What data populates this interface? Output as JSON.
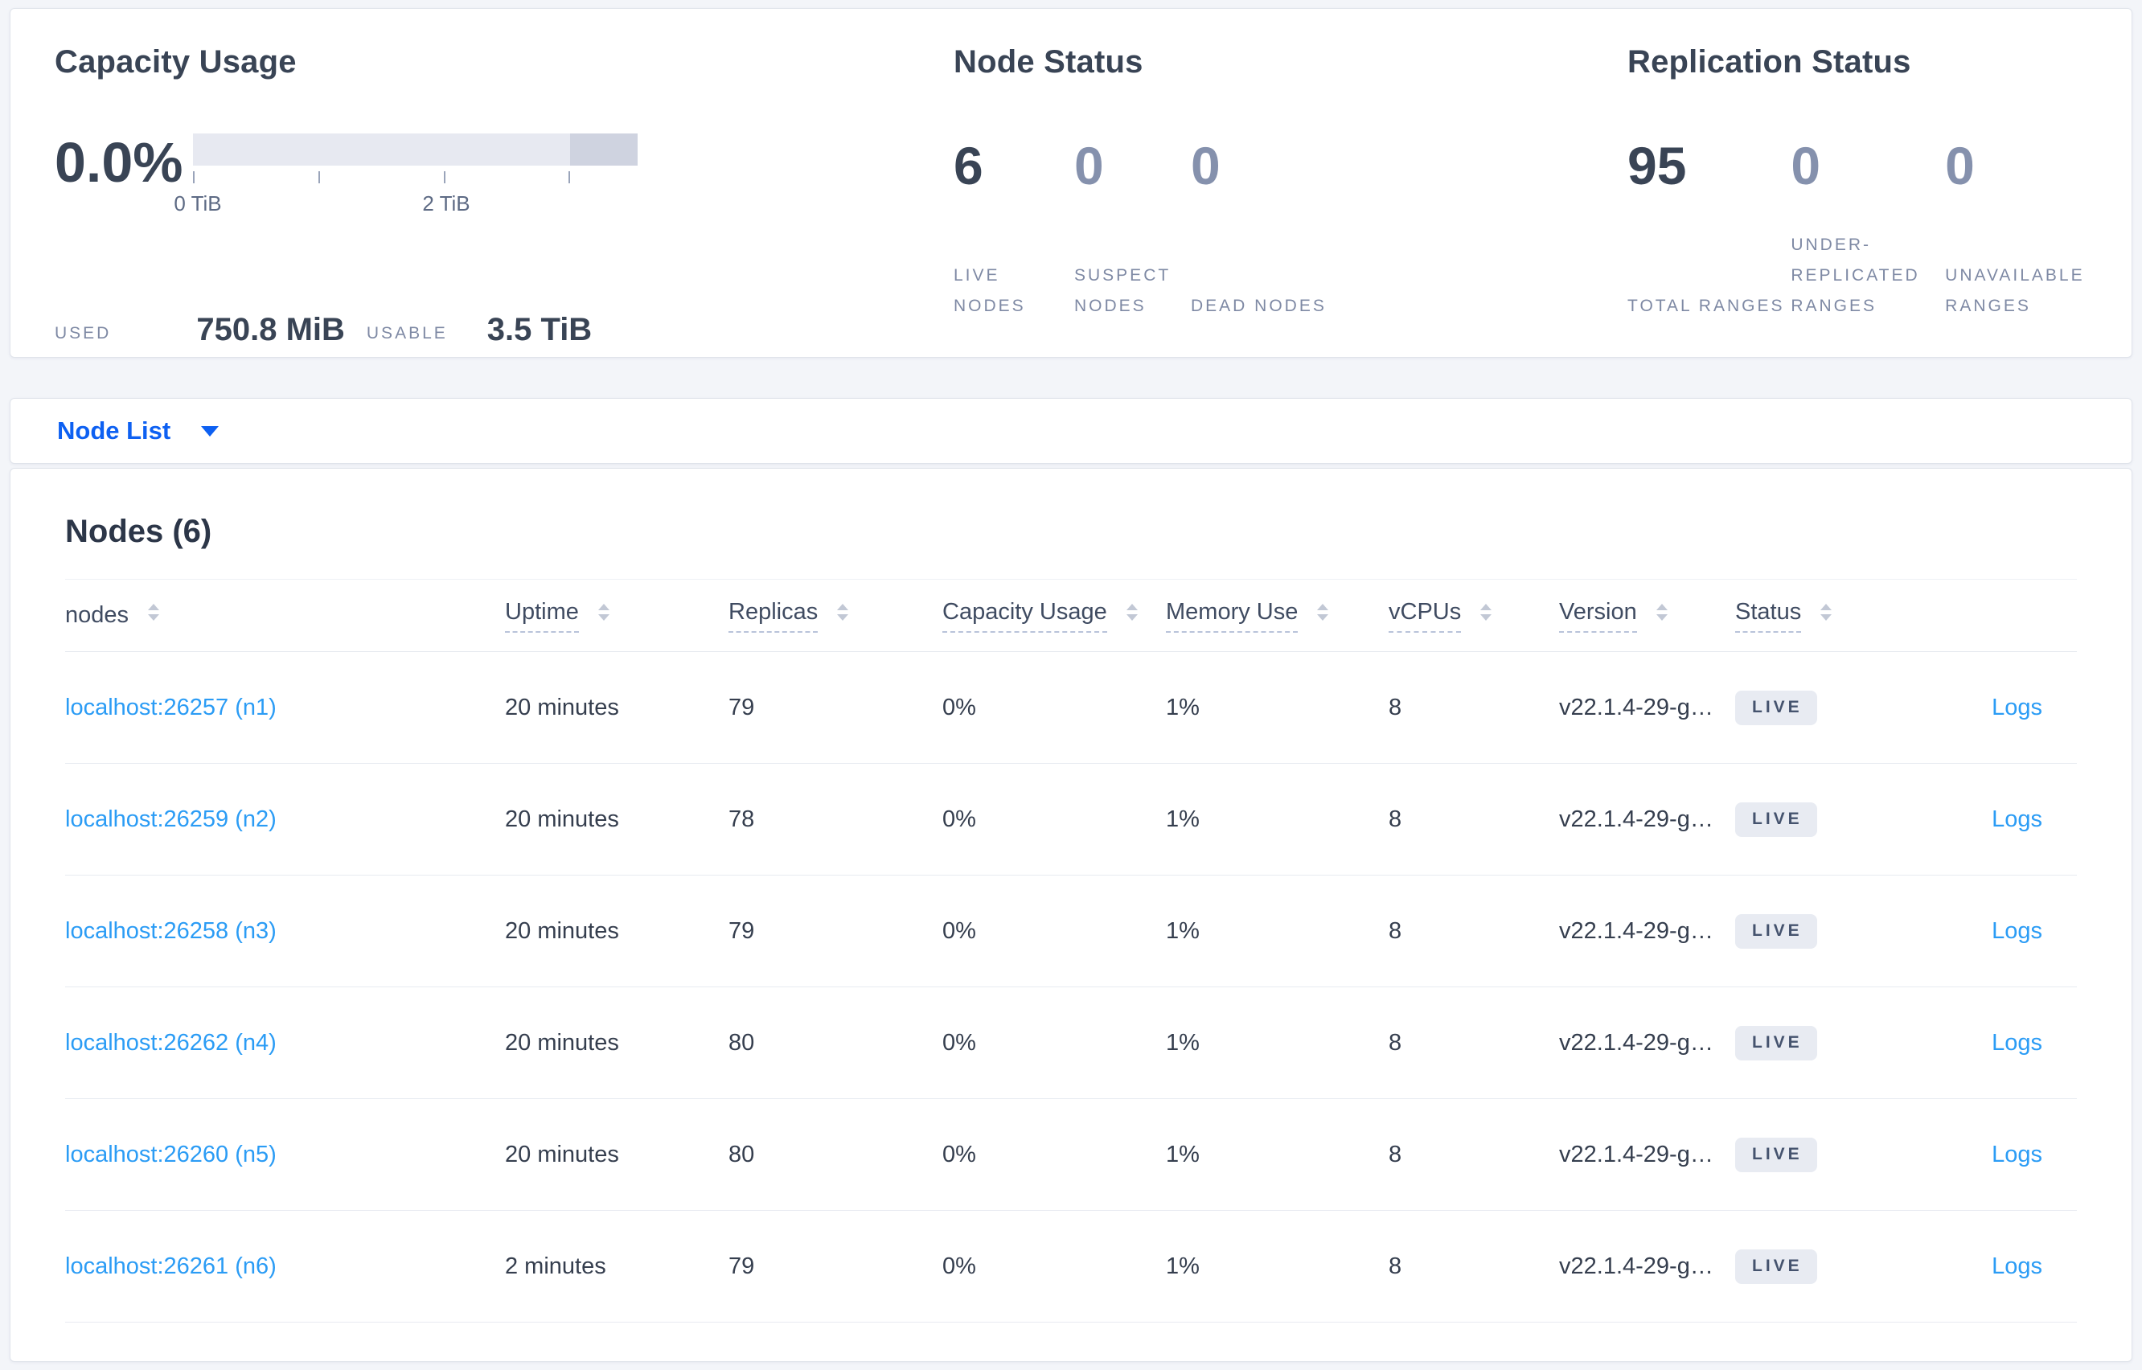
{
  "colors": {
    "accent_blue": "#0d60f2",
    "link_blue": "#2b9cf5",
    "dark_text": "#394455",
    "muted_text": "#7e89a4",
    "badge_bg": "#e8ebf2",
    "bar_track": "#e7e9f1",
    "bar_extra": "#cfd3e0"
  },
  "capacity": {
    "title": "Capacity Usage",
    "percent": "0.0%",
    "tick_label_0": "0 TiB",
    "tick_label_2": "2 TiB",
    "used_label": "USED",
    "used_value": "750.8 MiB",
    "usable_label": "USABLE",
    "usable_value": "3.5 TiB"
  },
  "node_status": {
    "title": "Node Status",
    "stats": [
      {
        "value": "6",
        "label": "LIVE NODES"
      },
      {
        "value": "0",
        "label": "SUSPECT NODES"
      },
      {
        "value": "0",
        "label": "DEAD NODES"
      }
    ]
  },
  "replication": {
    "title": "Replication Status",
    "stats": [
      {
        "value": "95",
        "label": "TOTAL RANGES"
      },
      {
        "value": "0",
        "label": "UNDER-REPLICATED RANGES"
      },
      {
        "value": "0",
        "label": "UNAVAILABLE RANGES"
      }
    ]
  },
  "node_list": {
    "label": "Node List"
  },
  "table": {
    "title": "Nodes (6)",
    "columns": {
      "node": "nodes",
      "uptime": "Uptime",
      "replicas": "Replicas",
      "capacity": "Capacity Usage",
      "memory": "Memory Use",
      "vcpus": "vCPUs",
      "version": "Version",
      "status": "Status"
    },
    "rows": [
      {
        "node": "localhost:26257 (n1)",
        "uptime": "20 minutes",
        "replicas": "79",
        "capacity": "0%",
        "memory": "1%",
        "vcpus": "8",
        "version": "v22.1.4-29-g…",
        "status": "LIVE",
        "logs": "Logs"
      },
      {
        "node": "localhost:26259 (n2)",
        "uptime": "20 minutes",
        "replicas": "78",
        "capacity": "0%",
        "memory": "1%",
        "vcpus": "8",
        "version": "v22.1.4-29-g…",
        "status": "LIVE",
        "logs": "Logs"
      },
      {
        "node": "localhost:26258 (n3)",
        "uptime": "20 minutes",
        "replicas": "79",
        "capacity": "0%",
        "memory": "1%",
        "vcpus": "8",
        "version": "v22.1.4-29-g…",
        "status": "LIVE",
        "logs": "Logs"
      },
      {
        "node": "localhost:26262 (n4)",
        "uptime": "20 minutes",
        "replicas": "80",
        "capacity": "0%",
        "memory": "1%",
        "vcpus": "8",
        "version": "v22.1.4-29-g…",
        "status": "LIVE",
        "logs": "Logs"
      },
      {
        "node": "localhost:26260 (n5)",
        "uptime": "20 minutes",
        "replicas": "80",
        "capacity": "0%",
        "memory": "1%",
        "vcpus": "8",
        "version": "v22.1.4-29-g…",
        "status": "LIVE",
        "logs": "Logs"
      },
      {
        "node": "localhost:26261 (n6)",
        "uptime": "2 minutes",
        "replicas": "79",
        "capacity": "0%",
        "memory": "1%",
        "vcpus": "8",
        "version": "v22.1.4-29-g…",
        "status": "LIVE",
        "logs": "Logs"
      }
    ]
  }
}
